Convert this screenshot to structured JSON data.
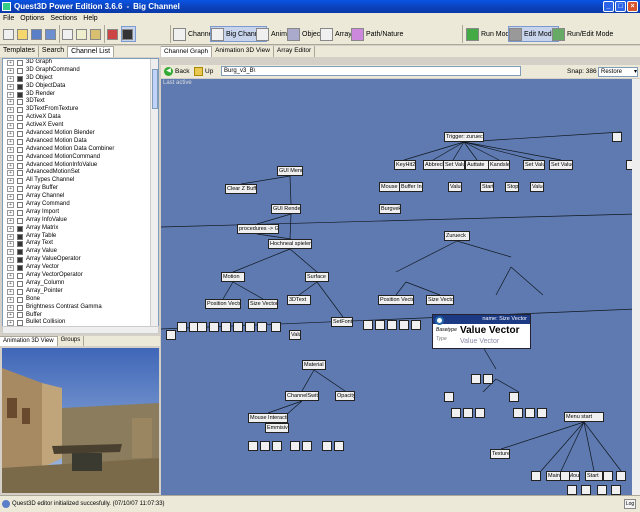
{
  "window": {
    "title": "Quest3D Power Edition 3.6.6",
    "channel": "Big Channel"
  },
  "menu": [
    "File",
    "Options",
    "Sections",
    "Help"
  ],
  "toolbar": {
    "channel": "Channel",
    "big_channel": "Big Channel",
    "anim": "Anim",
    "object": "Object",
    "array": "Array",
    "path_nature": "Path/Nature",
    "run_mode": "Run Mode",
    "edit_mode": "Edit Mode",
    "run_edit_mode": "Run/Edit Mode"
  },
  "left_tabs": [
    "Templates",
    "Search",
    "Channel List"
  ],
  "channel_list": [
    "3D Graph",
    "3D GraphCommand",
    "3D Object",
    "3D ObjectData",
    "3D Render",
    "3DText",
    "3DTextFromTexture",
    "ActiveX Data",
    "ActiveX Event",
    "Advanced Motion Blender",
    "Advanced Motion Data",
    "Advanced Motion Data Combiner",
    "Advanced MotionCommand",
    "Advanced MotionInfoValue",
    "AdvancedMotionSet",
    "All Types Channel",
    "Array Buffer",
    "Array Channel",
    "Array Command",
    "Array Import",
    "Array InfoValue",
    "Array Matrix",
    "Array Table",
    "Array Text",
    "Array Value",
    "Array ValueOperator",
    "Array Vector",
    "Array VectorOperator",
    "Array_Column",
    "Array_Pointer",
    "Bone",
    "Brightness Contrast Gamma",
    "Buffer",
    "Bullet Collision"
  ],
  "left_bottom_tabs": [
    "Animation 3D View",
    "Groups"
  ],
  "right_tabs": [
    "Channel Graph",
    "Animation 3D View",
    "Array Editor"
  ],
  "nav": {
    "back": "Back",
    "up": "Up",
    "path": "Burg_v3_B\\",
    "snap": "Snap: 386",
    "restore": "Restore"
  },
  "graph": {
    "last_active": "Last active",
    "nodes": [
      "Trigger: zurueck",
      "KeyHit2",
      "Abbreche",
      "Set Value",
      "Auttate",
      "Kandsle",
      "Set Value",
      "Set Value",
      "GUI Menu",
      "Clear Z Buffer",
      "Mouse Interactor",
      "Buffer Input",
      "Value",
      "Start",
      "Stop",
      "Value",
      "Burgvek",
      "GUI Render",
      "procedures -> GUI",
      "Zurueck",
      "Hochneal spielen",
      "Motion",
      "Surface",
      "Position Vector",
      "Size Vector",
      "3DText",
      "Size Vector",
      "Position Vector",
      "Value",
      "SetFont",
      "Material",
      "ChannelSwitch",
      "Opacity",
      "Mouse Interactio",
      "Emmisive",
      "Menu start",
      "Texture",
      "MainGuiMouse",
      "Start"
    ]
  },
  "tooltip": {
    "name_prefix": "name:",
    "name": "Size Vector",
    "basetype_label": "Basetype",
    "type_label": "Type",
    "title": "Value Vector",
    "subtitle": "Value Vector"
  },
  "status": "Quest3D editor initialized succesfully. (07/10/07 11:07:33)",
  "log_button": "Log"
}
